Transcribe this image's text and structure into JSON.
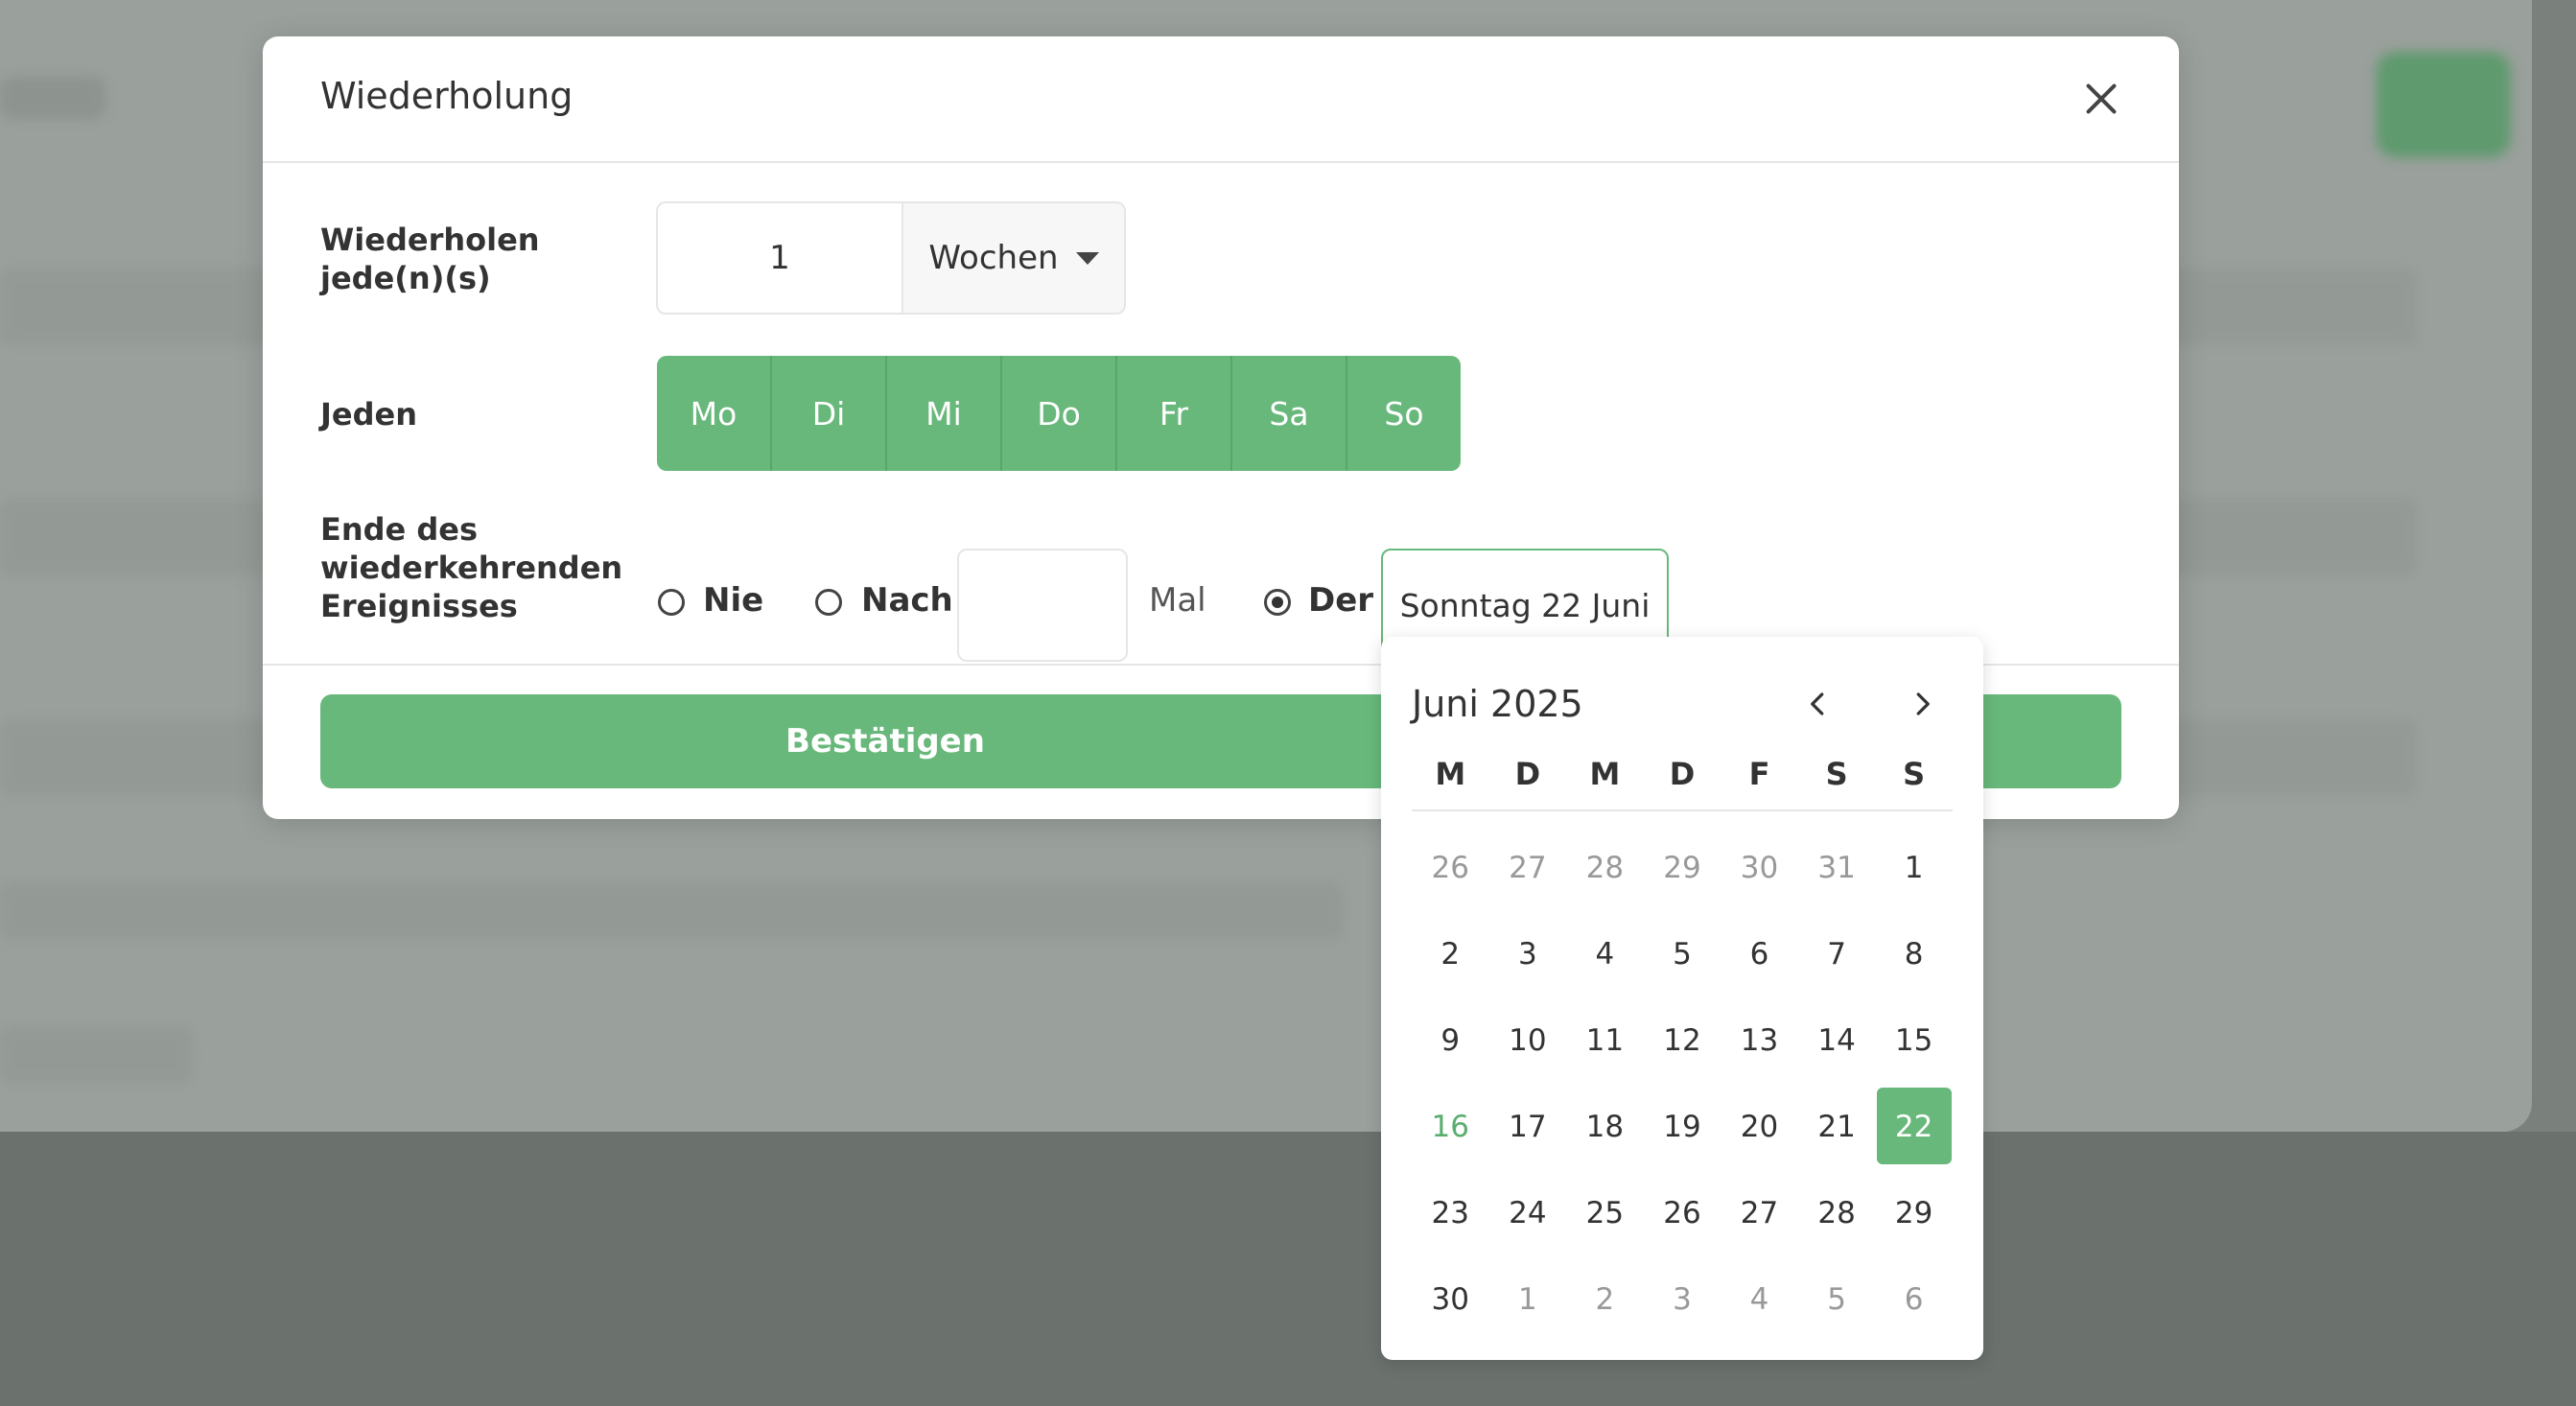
{
  "modal": {
    "title": "Wiederholung",
    "repeat_label": "Wiederholen jede(n)(s)",
    "interval_value": "1",
    "unit_value": "Wochen",
    "each_label": "Jeden",
    "weekdays": [
      "Mo",
      "Di",
      "Mi",
      "Do",
      "Fr",
      "Sa",
      "So"
    ],
    "end_label": "Ende des wiederkehrenden Ereignisses",
    "end_options": {
      "never": "Nie",
      "after": "Nach",
      "after_count": "",
      "times_label": "Mal",
      "on": "Der",
      "selected": "on"
    },
    "end_date": "Sonntag 22 Juni",
    "confirm_label": "Bestätigen"
  },
  "datepicker": {
    "title": "Juni 2025",
    "weekday_headers": [
      "M",
      "D",
      "M",
      "D",
      "F",
      "S",
      "S"
    ],
    "weeks": [
      [
        {
          "d": "26",
          "muted": true
        },
        {
          "d": "27",
          "muted": true
        },
        {
          "d": "28",
          "muted": true
        },
        {
          "d": "29",
          "muted": true
        },
        {
          "d": "30",
          "muted": true
        },
        {
          "d": "31",
          "muted": true
        },
        {
          "d": "1"
        }
      ],
      [
        {
          "d": "2"
        },
        {
          "d": "3"
        },
        {
          "d": "4"
        },
        {
          "d": "5"
        },
        {
          "d": "6"
        },
        {
          "d": "7"
        },
        {
          "d": "8"
        }
      ],
      [
        {
          "d": "9"
        },
        {
          "d": "10"
        },
        {
          "d": "11"
        },
        {
          "d": "12"
        },
        {
          "d": "13"
        },
        {
          "d": "14"
        },
        {
          "d": "15"
        }
      ],
      [
        {
          "d": "16",
          "today": true
        },
        {
          "d": "17"
        },
        {
          "d": "18"
        },
        {
          "d": "19"
        },
        {
          "d": "20"
        },
        {
          "d": "21"
        },
        {
          "d": "22",
          "selected": true
        }
      ],
      [
        {
          "d": "23"
        },
        {
          "d": "24"
        },
        {
          "d": "25"
        },
        {
          "d": "26"
        },
        {
          "d": "27"
        },
        {
          "d": "28"
        },
        {
          "d": "29"
        }
      ],
      [
        {
          "d": "30"
        },
        {
          "d": "1",
          "muted": true
        },
        {
          "d": "2",
          "muted": true
        },
        {
          "d": "3",
          "muted": true
        },
        {
          "d": "4",
          "muted": true
        },
        {
          "d": "5",
          "muted": true
        },
        {
          "d": "6",
          "muted": true
        }
      ]
    ]
  },
  "colors": {
    "accent": "#68b87b",
    "today": "#5aae6e",
    "overlay": "#7a817d"
  }
}
